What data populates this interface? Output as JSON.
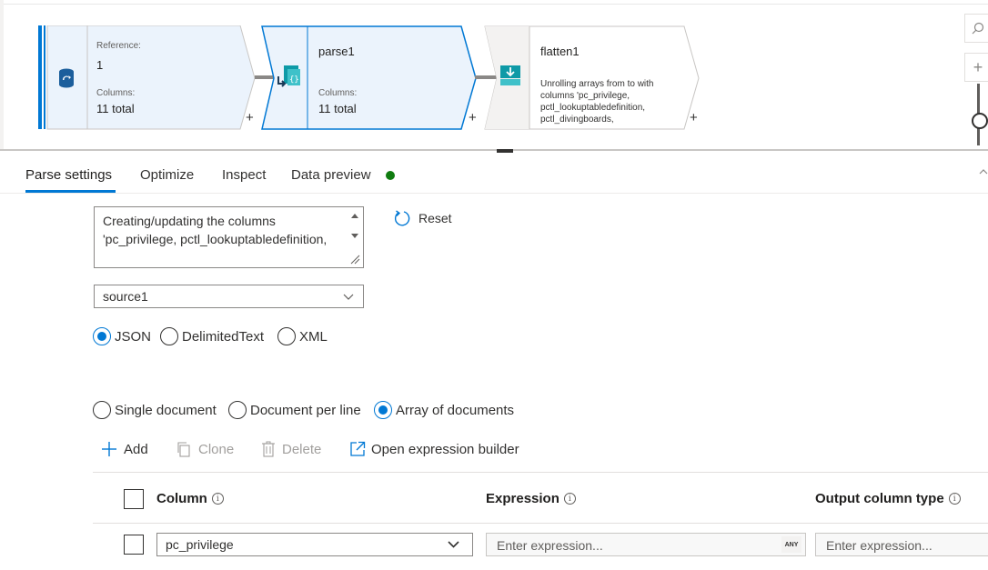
{
  "canvas": {
    "nodes": [
      {
        "id": "source1",
        "ref_label": "Reference:",
        "ref_value": "1",
        "columns_label": "Columns:",
        "columns_value": "11 total",
        "add_label": "+"
      },
      {
        "id": "parse1",
        "title": "parse1",
        "columns_label": "Columns:",
        "columns_value": "11 total",
        "add_label": "+"
      },
      {
        "id": "flatten1",
        "title": "flatten1",
        "description": "Unrolling arrays from  to  with columns 'pc_privilege, pctl_lookuptabledefinition, pctl_divingboards,",
        "add_label": "+"
      }
    ],
    "zoom": {
      "search_icon": "search-icon",
      "zoom_in_label": "+"
    }
  },
  "tabs": [
    {
      "label": "Parse settings",
      "active": true
    },
    {
      "label": "Optimize",
      "active": false
    },
    {
      "label": "Inspect",
      "active": false
    },
    {
      "label": "Data preview",
      "active": false,
      "status_color": "#107c10"
    }
  ],
  "settings": {
    "description_text": "Creating/updating the columns 'pc_privilege, pctl_lookuptabledefinition,",
    "reset_label": "Reset",
    "incoming_stream": "source1",
    "format_options": [
      {
        "label": "JSON",
        "checked": true
      },
      {
        "label": "DelimitedText",
        "checked": false
      },
      {
        "label": "XML",
        "checked": false
      }
    ],
    "document_form_options": [
      {
        "label": "Single document",
        "checked": false
      },
      {
        "label": "Document per line",
        "checked": false
      },
      {
        "label": "Array of documents",
        "checked": true
      }
    ]
  },
  "toolbar": {
    "add_label": "Add",
    "clone_label": "Clone",
    "delete_label": "Delete",
    "expression_builder_label": "Open expression builder"
  },
  "grid": {
    "headers": {
      "column": "Column",
      "expression": "Expression",
      "output_type": "Output column type"
    },
    "rows": [
      {
        "column": "pc_privilege",
        "expression_placeholder": "Enter expression...",
        "type_badge": "ANY",
        "output_placeholder": "Enter expression..."
      }
    ]
  },
  "colors": {
    "accent": "#0078d4",
    "node_fill": "#ebf3fc",
    "selected_node_fill": "#ebf3fc",
    "node_fill_plain": "#f3f2f1",
    "status_green": "#107c10",
    "teal_icon": "#0e9aa7"
  }
}
